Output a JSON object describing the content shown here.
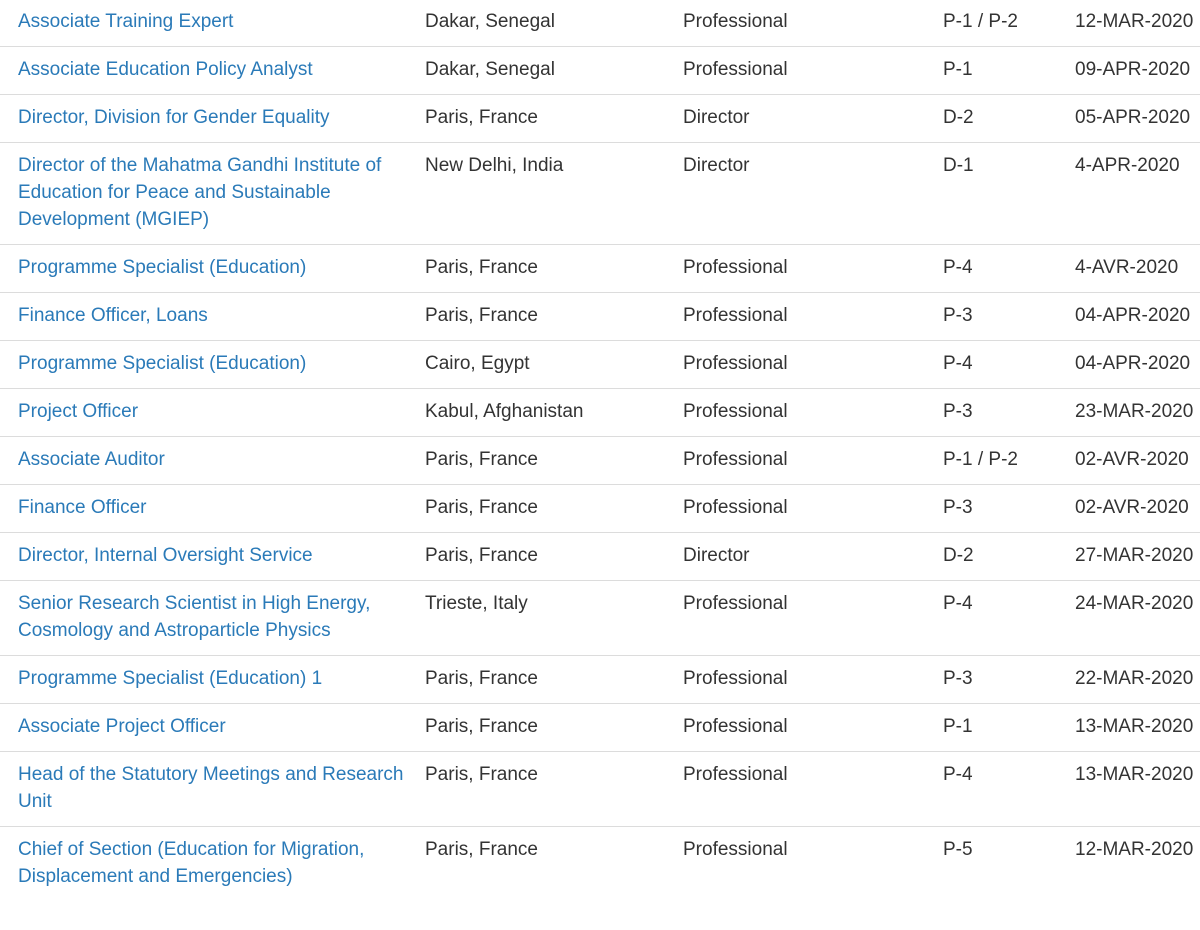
{
  "jobs": [
    {
      "title": "Associate Training Expert",
      "location": "Dakar, Senegal",
      "category": "Professional",
      "grade": "P-1 / P-2",
      "deadline": "12-MAR-2020"
    },
    {
      "title": "Associate Education Policy Analyst",
      "location": "Dakar, Senegal",
      "category": "Professional",
      "grade": "P-1",
      "deadline": "09-APR-2020"
    },
    {
      "title": "Director, Division for Gender Equality",
      "location": "Paris, France",
      "category": "Director",
      "grade": "D-2",
      "deadline": "05-APR-2020"
    },
    {
      "title": "Director of the Mahatma Gandhi Institute of Education for Peace and Sustainable Development (MGIEP)",
      "location": "New Delhi, India",
      "category": "Director",
      "grade": "D-1",
      "deadline": "4-APR-2020"
    },
    {
      "title": "Programme Specialist (Education)",
      "location": "Paris, France",
      "category": "Professional",
      "grade": "P-4",
      "deadline": "4-AVR-2020"
    },
    {
      "title": "Finance Officer, Loans",
      "location": "Paris, France",
      "category": "Professional",
      "grade": "P-3",
      "deadline": "04-APR-2020"
    },
    {
      "title": "Programme Specialist (Education)",
      "location": "Cairo, Egypt",
      "category": "Professional",
      "grade": "P-4",
      "deadline": "04-APR-2020"
    },
    {
      "title": "Project Officer",
      "location": "Kabul, Afghanistan",
      "category": "Professional",
      "grade": "P-3",
      "deadline": "23-MAR-2020"
    },
    {
      "title": "Associate Auditor",
      "location": "Paris, France",
      "category": "Professional",
      "grade": "P-1 / P-2",
      "deadline": "02-AVR-2020"
    },
    {
      "title": "Finance Officer",
      "location": "Paris, France",
      "category": "Professional",
      "grade": "P-3",
      "deadline": "02-AVR-2020"
    },
    {
      "title": "Director, Internal Oversight Service",
      "location": "Paris, France",
      "category": "Director",
      "grade": "D-2",
      "deadline": "27-MAR-2020"
    },
    {
      "title": "Senior Research Scientist in High Energy, Cosmology and Astroparticle Physics",
      "location": "Trieste, Italy",
      "category": "Professional",
      "grade": "P-4",
      "deadline": "24-MAR-2020"
    },
    {
      "title": "Programme Specialist (Education) 1",
      "location": "Paris, France",
      "category": "Professional",
      "grade": "P-3",
      "deadline": "22-MAR-2020"
    },
    {
      "title": "Associate Project Officer",
      "location": "Paris, France",
      "category": "Professional",
      "grade": "P-1",
      "deadline": "13-MAR-2020"
    },
    {
      "title": "Head of the Statutory Meetings and Research Unit",
      "location": "Paris, France",
      "category": "Professional",
      "grade": "P-4",
      "deadline": "13-MAR-2020"
    },
    {
      "title": "Chief of Section (Education for Migration, Displacement and Emergencies)",
      "location": "Paris, France",
      "category": "Professional",
      "grade": "P-5",
      "deadline": "12-MAR-2020"
    }
  ]
}
